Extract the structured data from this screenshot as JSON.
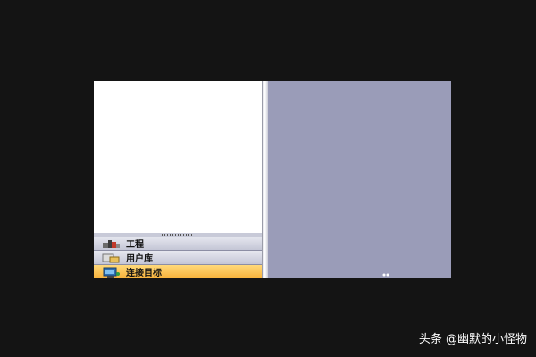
{
  "navigation": {
    "items": [
      {
        "label": "工程",
        "icon": "project-icon",
        "active": false
      },
      {
        "label": "用户库",
        "icon": "user-library-icon",
        "active": false
      },
      {
        "label": "连接目标",
        "icon": "connection-target-icon",
        "active": true
      }
    ]
  },
  "colors": {
    "desktop_background": "#141414",
    "tree_background": "#ffffff",
    "workspace_background": "#9a9cb8",
    "nav_active": "#f7b13a"
  },
  "watermark": {
    "text": "头条 @幽默的小怪物"
  }
}
